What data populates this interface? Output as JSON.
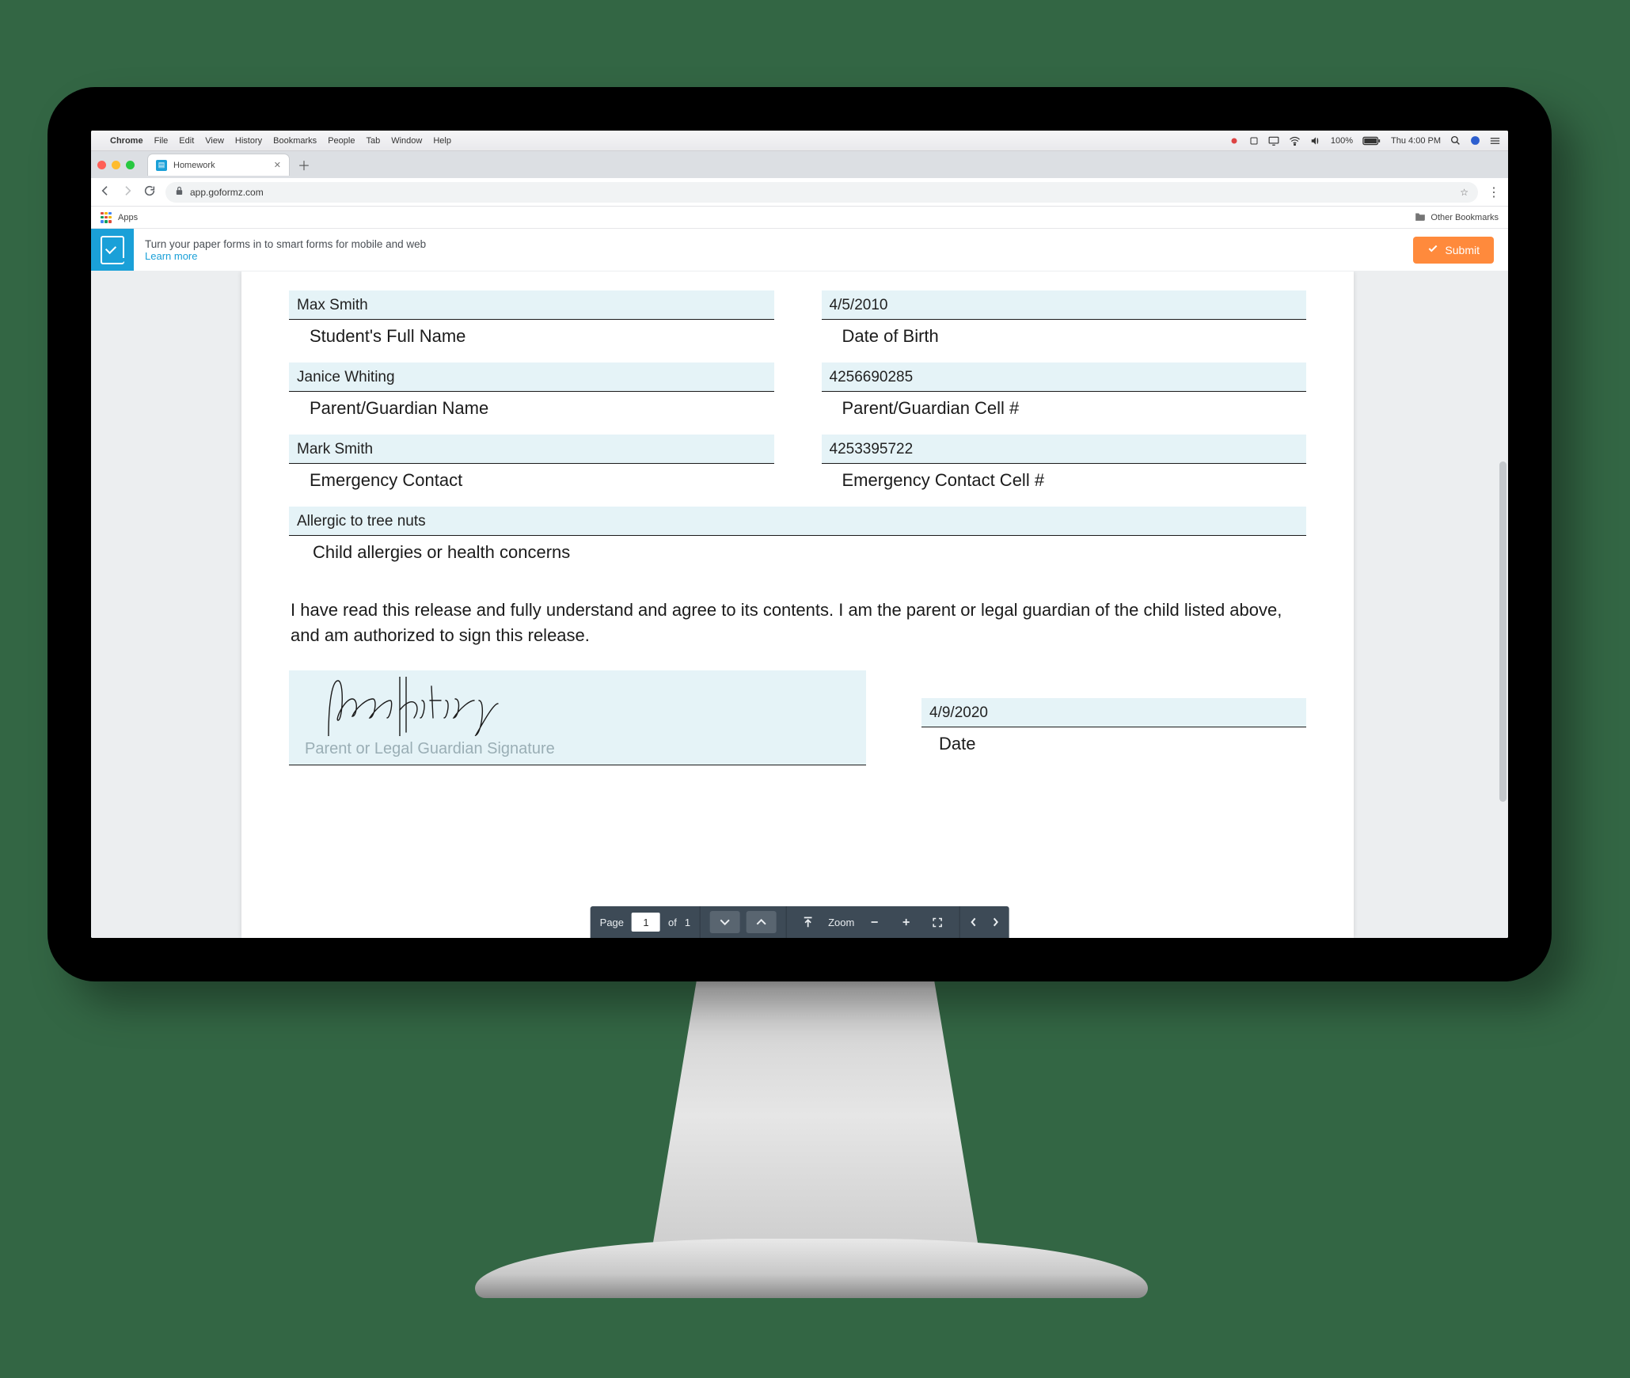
{
  "mac_menu": {
    "app": "Chrome",
    "items": [
      "File",
      "Edit",
      "View",
      "History",
      "Bookmarks",
      "People",
      "Tab",
      "Window",
      "Help"
    ],
    "battery": "100%",
    "clock": "Thu 4:00 PM"
  },
  "browser": {
    "tab_title": "Homework",
    "url": "app.goformz.com",
    "apps_label": "Apps",
    "other_bookmarks": "Other Bookmarks"
  },
  "appbar": {
    "tagline": "Turn your paper forms in to smart forms for mobile and web",
    "learn_more": "Learn more",
    "submit": "Submit"
  },
  "form": {
    "student_name": {
      "value": "Max Smith",
      "label": "Student's Full Name"
    },
    "dob": {
      "value": "4/5/2010",
      "label": "Date of Birth"
    },
    "guardian_name": {
      "value": "Janice Whiting",
      "label": "Parent/Guardian Name"
    },
    "guardian_cell": {
      "value": "4256690285",
      "label": "Parent/Guardian Cell #"
    },
    "emergency_name": {
      "value": "Mark Smith",
      "label": "Emergency Contact"
    },
    "emergency_cell": {
      "value": "4253395722",
      "label": "Emergency Contact Cell #"
    },
    "allergies": {
      "value": "Allergic to tree nuts",
      "label": "Child allergies or health concerns"
    },
    "release_text": "I have read this release and fully understand and agree to its contents. I am the parent or legal guardian of the child listed above, and am authorized to sign this release.",
    "signature_placeholder": "Parent or Legal Guardian Signature",
    "sign_date": {
      "value": "4/9/2020",
      "label": "Date"
    }
  },
  "pager": {
    "page_label": "Page",
    "page_current": "1",
    "of_label": "of",
    "page_total": "1",
    "zoom_label": "Zoom"
  }
}
